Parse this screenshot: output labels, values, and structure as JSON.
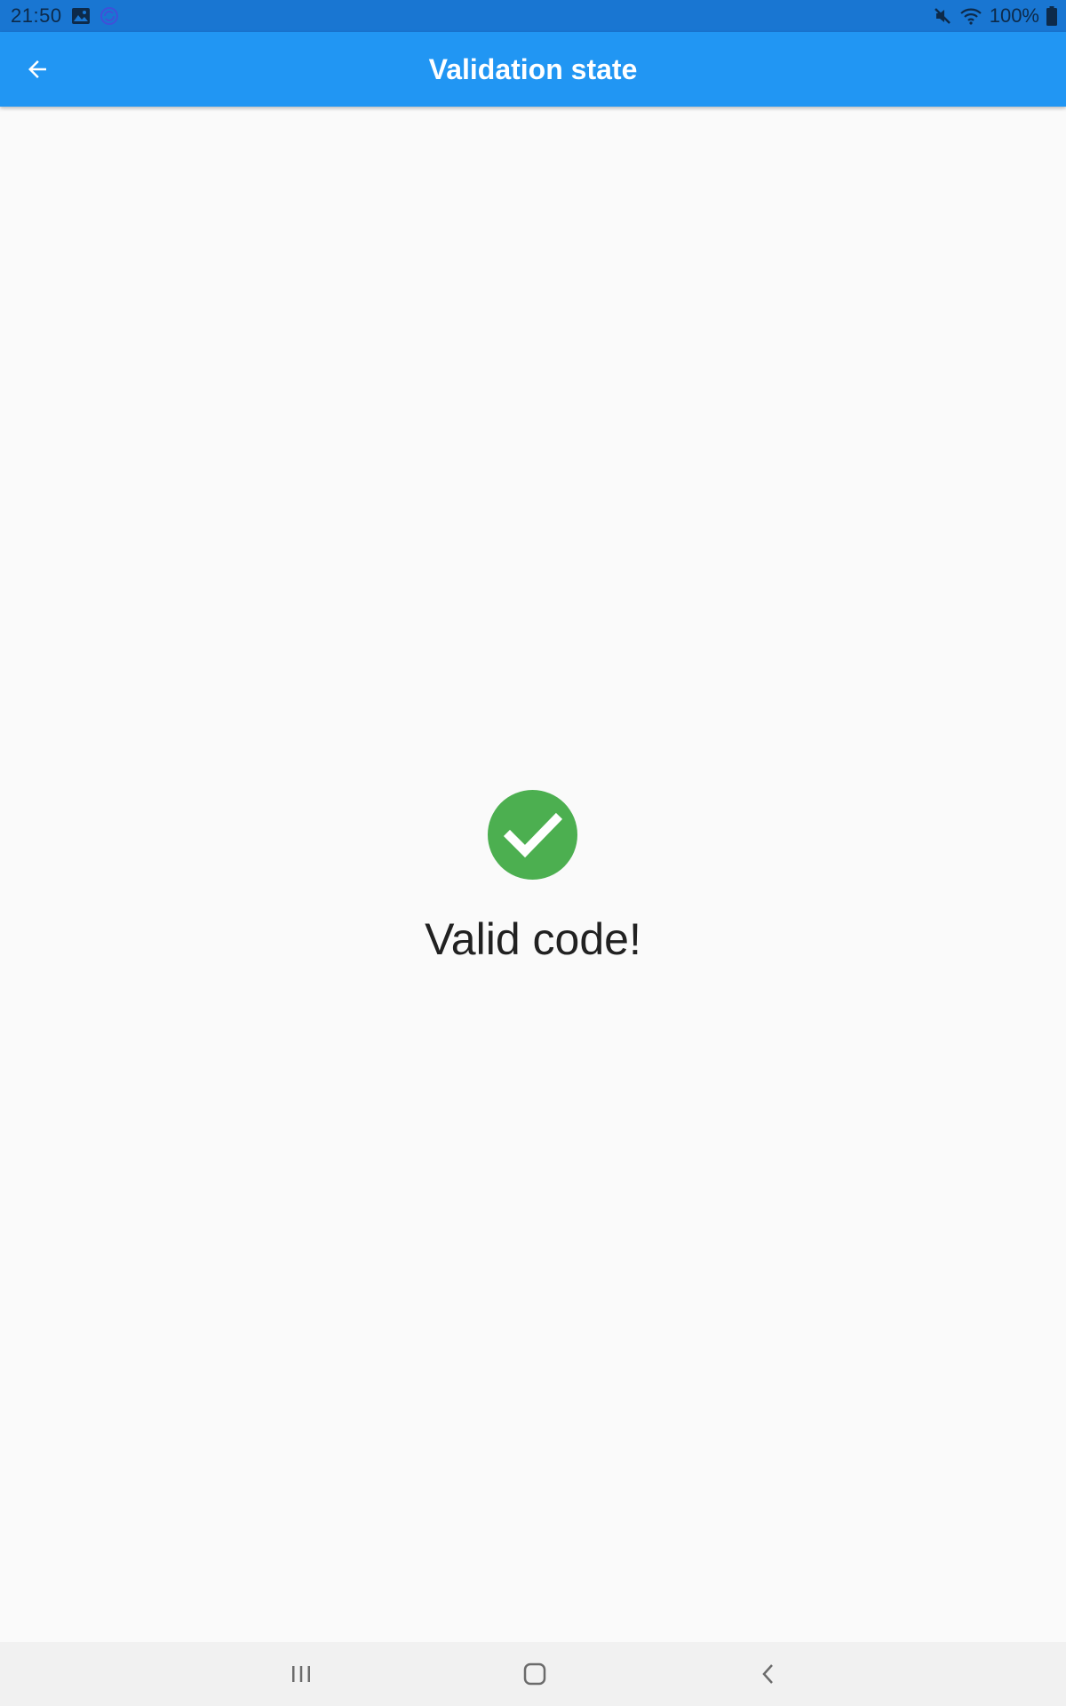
{
  "status_bar": {
    "time": "21:50",
    "battery": "100%",
    "icons": [
      "image-icon",
      "sync-icon",
      "mute-icon",
      "wifi-icon",
      "battery-icon"
    ]
  },
  "app_bar": {
    "title": "Validation state",
    "back_icon": "arrow-back-icon"
  },
  "content": {
    "status_icon": "check-circle-icon",
    "message": "Valid code!"
  },
  "nav_bar": {
    "buttons": [
      "recents",
      "home",
      "back"
    ]
  },
  "colors": {
    "app_bar": "#2196f3",
    "status_bar": "#1976d2",
    "success": "#4caf50",
    "background": "#fafafa",
    "text": "#212121"
  }
}
